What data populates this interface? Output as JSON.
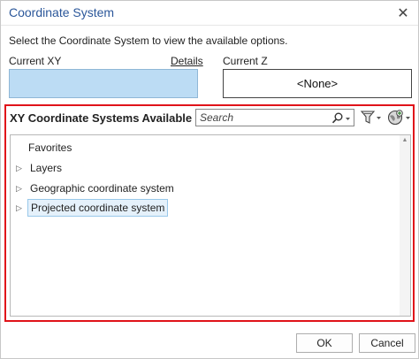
{
  "window": {
    "title": "Coordinate System",
    "close_glyph": "✕"
  },
  "instruction": "Select the Coordinate System to view the available options.",
  "current_xy": {
    "label": "Current XY",
    "details_link": "Details",
    "value": ""
  },
  "current_z": {
    "label": "Current Z",
    "value": "<None>"
  },
  "available": {
    "title": "XY Coordinate Systems Available",
    "search": {
      "placeholder": "Search",
      "value": ""
    },
    "tree": [
      {
        "label": "Favorites",
        "expandable": false,
        "selected": false
      },
      {
        "label": "Layers",
        "expandable": true,
        "selected": false
      },
      {
        "label": "Geographic coordinate system",
        "expandable": true,
        "selected": false
      },
      {
        "label": "Projected coordinate system",
        "expandable": true,
        "selected": true
      }
    ]
  },
  "buttons": {
    "ok": "OK",
    "cancel": "Cancel"
  },
  "colors": {
    "title_blue": "#2b579a",
    "highlight_red": "#e0131a",
    "xy_fill": "#bcdcf4",
    "selection_fill": "#e5f1fb"
  },
  "icons": {
    "close": "close-icon",
    "search": "search-icon",
    "filter": "filter-icon",
    "globe": "globe-icon",
    "expander": "triangle-right-icon"
  }
}
